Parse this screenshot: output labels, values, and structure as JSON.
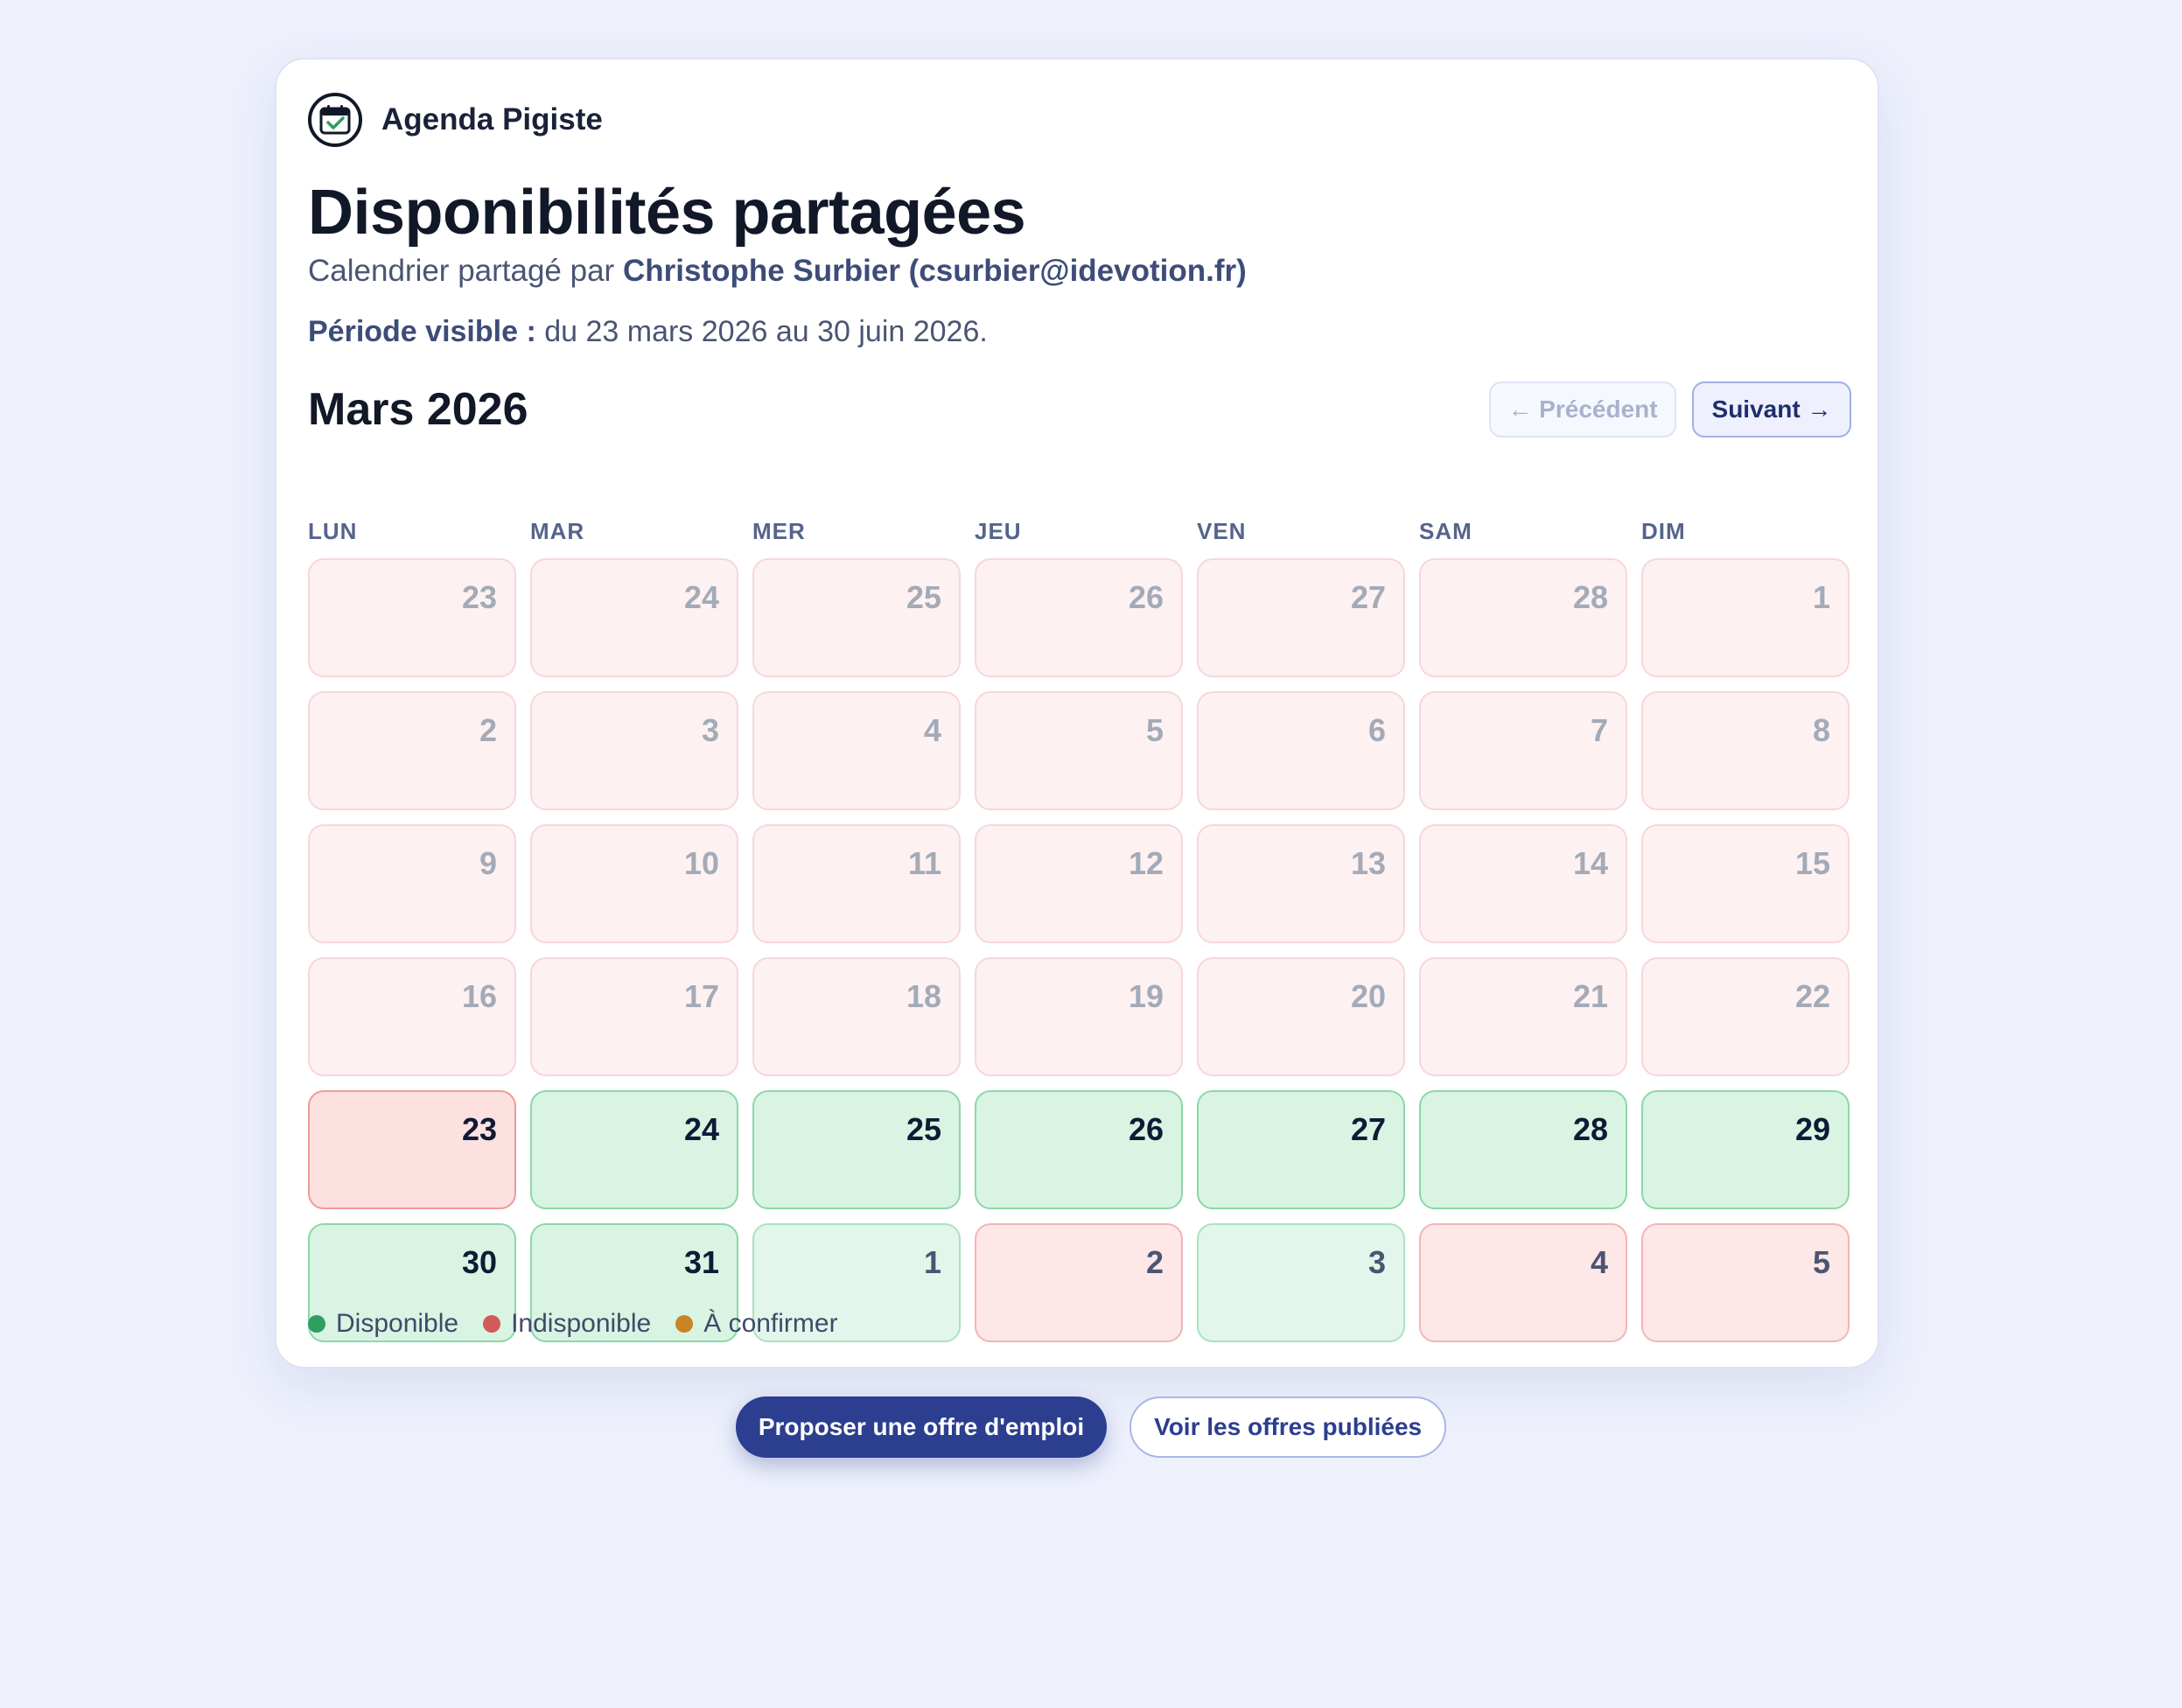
{
  "app": {
    "name": "Agenda Pigiste",
    "logo_icon": "calendar-check-icon"
  },
  "header": {
    "title": "Disponibilités partagées",
    "subtitle_prefix": "Calendrier partagé par",
    "owner": "Christophe Surbier (csurbier@idevotion.fr)",
    "period_label": "Période visible :",
    "period_value": "du 23 mars 2026 au 30 juin 2026."
  },
  "calendar": {
    "month_label": "Mars 2026",
    "prev_label": "← Précédent",
    "next_label": "Suivant →",
    "weekdays": [
      "LUN",
      "MAR",
      "MER",
      "JEU",
      "VEN",
      "SAM",
      "DIM"
    ],
    "weeks": [
      [
        {
          "day": "23",
          "status": "past"
        },
        {
          "day": "24",
          "status": "past"
        },
        {
          "day": "25",
          "status": "past"
        },
        {
          "day": "26",
          "status": "past"
        },
        {
          "day": "27",
          "status": "past"
        },
        {
          "day": "28",
          "status": "past"
        },
        {
          "day": "1",
          "status": "past"
        }
      ],
      [
        {
          "day": "2",
          "status": "past"
        },
        {
          "day": "3",
          "status": "past"
        },
        {
          "day": "4",
          "status": "past"
        },
        {
          "day": "5",
          "status": "past"
        },
        {
          "day": "6",
          "status": "past"
        },
        {
          "day": "7",
          "status": "past"
        },
        {
          "day": "8",
          "status": "past"
        }
      ],
      [
        {
          "day": "9",
          "status": "past"
        },
        {
          "day": "10",
          "status": "past"
        },
        {
          "day": "11",
          "status": "past"
        },
        {
          "day": "12",
          "status": "past"
        },
        {
          "day": "13",
          "status": "past"
        },
        {
          "day": "14",
          "status": "past"
        },
        {
          "day": "15",
          "status": "past"
        }
      ],
      [
        {
          "day": "16",
          "status": "past"
        },
        {
          "day": "17",
          "status": "past"
        },
        {
          "day": "18",
          "status": "past"
        },
        {
          "day": "19",
          "status": "past"
        },
        {
          "day": "20",
          "status": "past"
        },
        {
          "day": "21",
          "status": "past"
        },
        {
          "day": "22",
          "status": "past"
        }
      ],
      [
        {
          "day": "23",
          "status": "unav"
        },
        {
          "day": "24",
          "status": "av"
        },
        {
          "day": "25",
          "status": "av"
        },
        {
          "day": "26",
          "status": "av"
        },
        {
          "day": "27",
          "status": "av"
        },
        {
          "day": "28",
          "status": "av"
        },
        {
          "day": "29",
          "status": "av"
        }
      ],
      [
        {
          "day": "30",
          "status": "av"
        },
        {
          "day": "31",
          "status": "av"
        },
        {
          "day": "1",
          "status": "av-next"
        },
        {
          "day": "2",
          "status": "unav-next"
        },
        {
          "day": "3",
          "status": "av-next"
        },
        {
          "day": "4",
          "status": "unav-next"
        },
        {
          "day": "5",
          "status": "unav-next"
        }
      ]
    ]
  },
  "legend": [
    {
      "label": "Disponible",
      "color": "#2f9e5f"
    },
    {
      "label": "Indisponible",
      "color": "#d15a5a"
    },
    {
      "label": "À confirmer",
      "color": "#c98424"
    }
  ],
  "actions": {
    "propose_label": "Proposer une offre d'emploi",
    "view_label": "Voir les offres publiées"
  }
}
